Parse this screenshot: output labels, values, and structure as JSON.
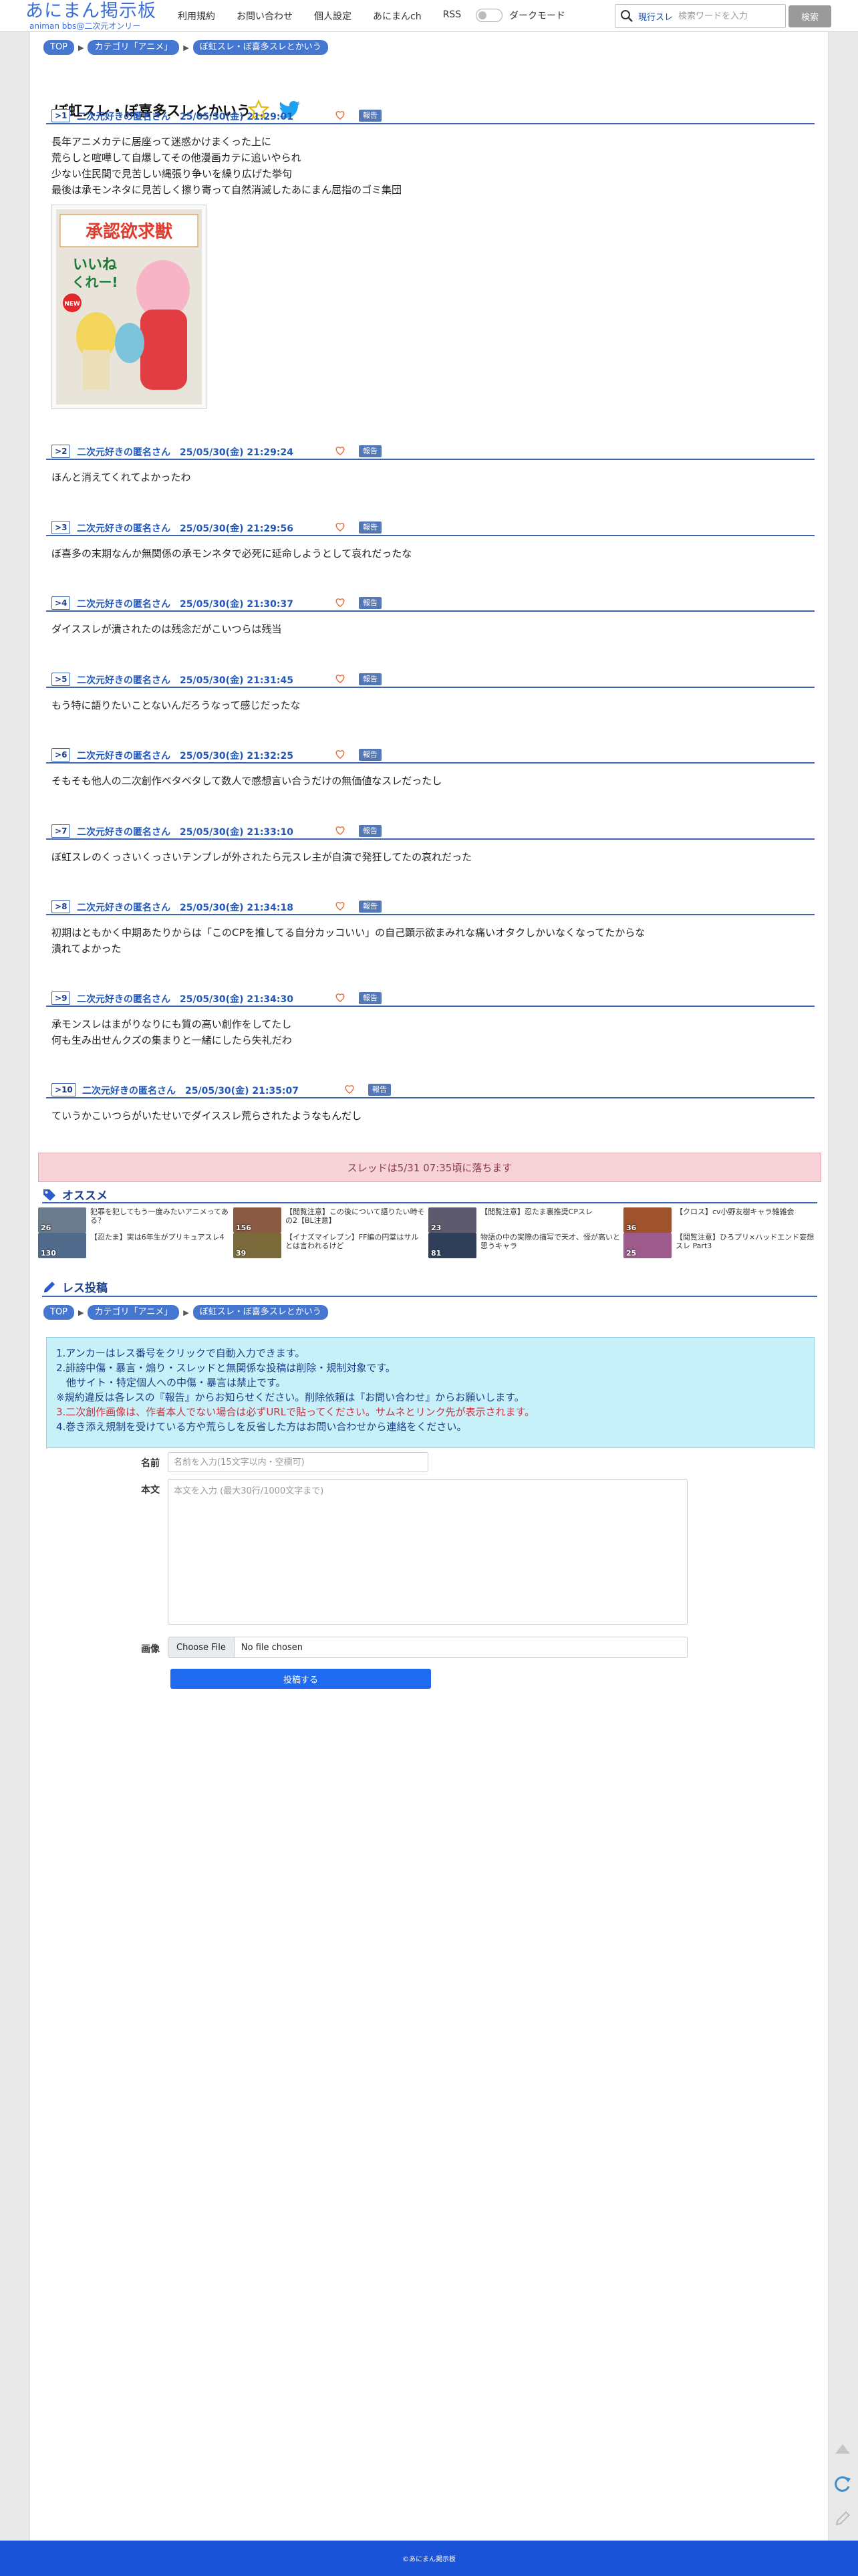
{
  "header": {
    "logo_main": "あにまん掲示板",
    "logo_sub": "animan bbs@二次元オンリー",
    "nav": [
      "利用規約",
      "お問い合わせ",
      "個人設定",
      "あにまんch",
      "RSS"
    ],
    "dark_mode_label": "ダークモード",
    "search_scope": "現行スレ",
    "search_placeholder": "検索ワードを入力",
    "search_button": "検索"
  },
  "breadcrumb": [
    "TOP",
    "カテゴリ「アニメ」",
    "ぼ虹スレ・ぼ喜多スレとかいう"
  ],
  "thread": {
    "title": "ぼ虹スレ・ぼ喜多スレとかいう"
  },
  "report_label": "報告",
  "posts": [
    {
      "num": "1",
      "meta": "二次元好きの匿名さん　25/05/30(金) 21:29:01",
      "lines": [
        "長年アニメカテに居座って迷惑かけまくった上に",
        "荒らしと喧嘩して自爆してその他漫画カテに追いやられ",
        "少ない住民間で見苦しい縄張り争いを繰り広げた挙句",
        "最後は承モンネタに見苦しく擦り寄って自然消滅したあにまん屈指のゴミ集団"
      ],
      "image_caption": [
        "承認欲求獣",
        "いいね",
        "くれー!",
        "NEW"
      ]
    },
    {
      "num": "2",
      "meta": "二次元好きの匿名さん　25/05/30(金) 21:29:24",
      "lines": [
        "ほんと消えてくれてよかったわ"
      ]
    },
    {
      "num": "3",
      "meta": "二次元好きの匿名さん　25/05/30(金) 21:29:56",
      "lines": [
        "ぼ喜多の末期なんか無関係の承モンネタで必死に延命しようとして哀れだったな"
      ]
    },
    {
      "num": "4",
      "meta": "二次元好きの匿名さん　25/05/30(金) 21:30:37",
      "lines": [
        "ダイススレが潰されたのは残念だがこいつらは残当"
      ]
    },
    {
      "num": "5",
      "meta": "二次元好きの匿名さん　25/05/30(金) 21:31:45",
      "lines": [
        "もう特に語りたいことないんだろうなって感じだったな"
      ]
    },
    {
      "num": "6",
      "meta": "二次元好きの匿名さん　25/05/30(金) 21:32:25",
      "lines": [
        "そもそも他人の二次創作ベタベタして数人で感想言い合うだけの無価値なスレだったし"
      ]
    },
    {
      "num": "7",
      "meta": "二次元好きの匿名さん　25/05/30(金) 21:33:10",
      "lines": [
        "ぼ虹スレのくっさいくっさいテンプレが外されたら元スレ主が自演で発狂してたの哀れだった"
      ]
    },
    {
      "num": "8",
      "meta": "二次元好きの匿名さん　25/05/30(金) 21:34:18",
      "lines": [
        "初期はともかく中期あたりからは「このCPを推してる自分カッコいい」の自己顕示欲まみれな痛いオタクしかいなくなってたからな",
        "潰れてよかった"
      ]
    },
    {
      "num": "9",
      "meta": "二次元好きの匿名さん　25/05/30(金) 21:34:30",
      "lines": [
        "承モンスレはまがりなりにも質の高い創作をしてたし",
        "何も生み出せんクズの集まりと一緒にしたら失礼だわ"
      ]
    },
    {
      "num": "10",
      "meta": "二次元好きの匿名さん　25/05/30(金) 21:35:07",
      "lines": [
        "ていうかこいつらがいたせいでダイススレ荒らされたようなもんだし"
      ]
    }
  ],
  "notice": "スレッドは5/31 07:35頃に落ちます",
  "recommend": {
    "title": "オススメ",
    "items": [
      {
        "title": "犯罪を犯してもう一度みたいアニメってある？",
        "count": "26",
        "color": "#6b7a8c"
      },
      {
        "title": "【閲覧注意】この後について語りたい時その2【BL注意】",
        "count": "156",
        "color": "#8a5a44"
      },
      {
        "title": "【閲覧注意】忍たま裏推奨CPスレ",
        "count": "23",
        "color": "#5d5a6e"
      },
      {
        "title": "【クロス】cv小野友樹キャラ雑雑会",
        "count": "36",
        "color": "#a0522d"
      },
      {
        "title": "【忍たま】実は6年生がプリキュアスレ4",
        "count": "130",
        "color": "#4f6a8a"
      },
      {
        "title": "【イナズマイレブン】FF編の円堂はサルとは言われるけど",
        "count": "39",
        "color": "#7a6a3a"
      },
      {
        "title": "物語の中の実際の描写で天才、怪が高いと思うキャラ",
        "count": "81",
        "color": "#2f3f5a"
      },
      {
        "title": "【閲覧注意】ひろプリ×ハッドエンド妄想スレ Part3",
        "count": "25",
        "color": "#9c5b8a"
      }
    ]
  },
  "post_form": {
    "title": "レス投稿",
    "info": [
      {
        "text": "1.アンカーはレス番号をクリックで自動入力できます。",
        "red": false
      },
      {
        "text": "2.誹謗中傷・暴言・煽り・スレッドと無関係な投稿は削除・規制対象です。",
        "red": false
      },
      {
        "text": "　他サイト・特定個人への中傷・暴言は禁止です。",
        "red": false
      },
      {
        "text": "※規約違反は各レスの『報告』からお知らせください。削除依頼は『お問い合わせ』からお願いします。",
        "red": false
      },
      {
        "text": "3.二次創作画像は、作者本人でない場合は必ずURLで貼ってください。サムネとリンク先が表示されます。",
        "red": true
      },
      {
        "text": "4.巻き添え規制を受けている方や荒らしを反省した方はお問い合わせから連絡をください。",
        "red": false
      }
    ],
    "name_label": "名前",
    "name_placeholder": "名前を入力(15文字以内・空欄可)",
    "body_label": "本文",
    "body_placeholder": "本文を入力 (最大30行/1000文字まで)",
    "image_label": "画像",
    "file_button": "Choose File",
    "file_status": "No file chosen",
    "submit": "投稿する"
  },
  "footer": "©あにまん掲示板",
  "colors": {
    "accent": "#3d64b0",
    "crumb": "#4576d0",
    "submit": "#1e6bf0",
    "footer": "#1a52d8"
  }
}
